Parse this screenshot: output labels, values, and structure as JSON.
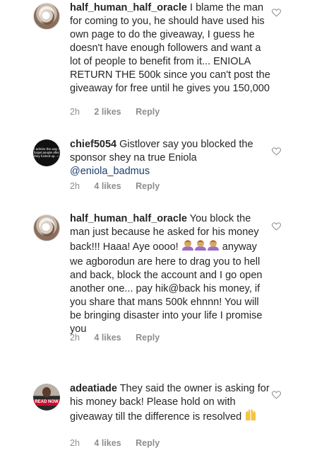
{
  "comments": [
    {
      "username": "half_human_half_oracle",
      "text": "I blame the man for coming to you, he should have used his own page to do the giveaway, I guess he doesn't have enough followers and want a lot of people to benefit from it... ENIOLA RETURN THE 500k since you can't post the giveaway for free until he gives you 150,000",
      "time": "2h",
      "likes": "2 likes",
      "reply": "Reply",
      "avatar_icon": "profile-photo"
    },
    {
      "username": "chief5054",
      "text": "Gistlover say you blocked the sponsor shey na true Eniola",
      "mention": "@eniola_badmus",
      "time": "2h",
      "likes": "4 likes",
      "reply": "Reply",
      "avatar_text": "I admire the way I forget people after they fucked up. ✓"
    },
    {
      "username": "half_human_half_oracle",
      "text_before_emoji": "You block the man just because he asked for his money back!!! Haaa! Aye oooo!",
      "text_after_emoji": "anyway we agborodun are here to drag you to hell and back, block the account and I go open another one... pay hik@back his money, if you share that mans 500k ehnnn! You will be bringing disaster into your life I promise you",
      "emoji": "facepalm-emoji",
      "time": "2h",
      "likes": "4 likes",
      "reply": "Reply"
    },
    {
      "username": "adeatiade",
      "text": "They said the owner is asking for his money back! Please hold on with giveaway till the difference is resolved",
      "emoji": "raised-hands-emoji",
      "time": "2h",
      "likes": "4 likes",
      "reply": "Reply",
      "avatar_text": "READ NOW"
    }
  ],
  "colors": {
    "text": "#262626",
    "meta": "#8e8e8e",
    "mention": "#1c3c6e",
    "badge": "#c8102e"
  }
}
